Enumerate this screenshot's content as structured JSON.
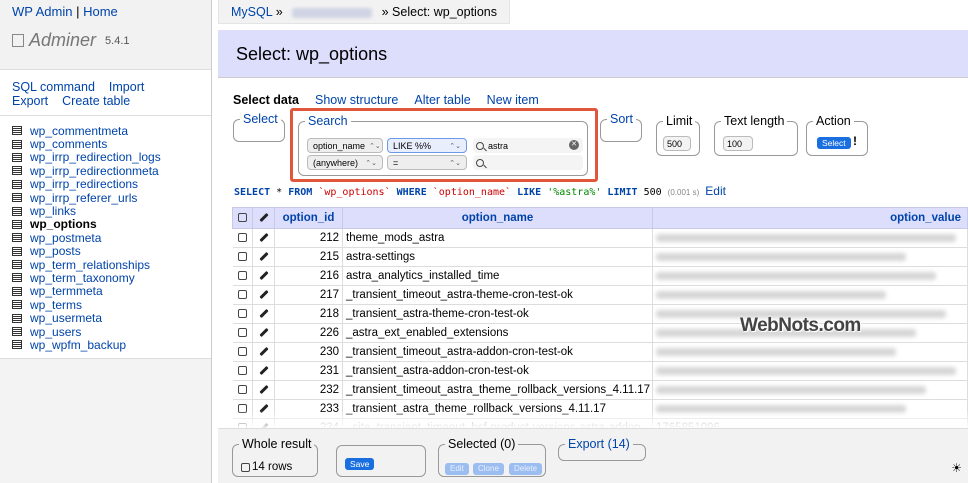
{
  "sidebar": {
    "top_links": [
      "WP Admin",
      "Home"
    ],
    "logo_text": "Adminer",
    "version": "5.4.1",
    "commands": {
      "sql": "SQL command",
      "import": "Import",
      "export": "Export",
      "create": "Create table"
    },
    "tables": [
      {
        "name": "wp_commentmeta",
        "active": false
      },
      {
        "name": "wp_comments",
        "active": false
      },
      {
        "name": "wp_irrp_redirection_logs",
        "active": false
      },
      {
        "name": "wp_irrp_redirectionmeta",
        "active": false
      },
      {
        "name": "wp_irrp_redirections",
        "active": false
      },
      {
        "name": "wp_irrp_referer_urls",
        "active": false
      },
      {
        "name": "wp_links",
        "active": false
      },
      {
        "name": "wp_options",
        "active": true
      },
      {
        "name": "wp_postmeta",
        "active": false
      },
      {
        "name": "wp_posts",
        "active": false
      },
      {
        "name": "wp_term_relationships",
        "active": false
      },
      {
        "name": "wp_term_taxonomy",
        "active": false
      },
      {
        "name": "wp_termmeta",
        "active": false
      },
      {
        "name": "wp_terms",
        "active": false
      },
      {
        "name": "wp_usermeta",
        "active": false
      },
      {
        "name": "wp_users",
        "active": false
      },
      {
        "name": "wp_wpfm_backup",
        "active": false
      }
    ]
  },
  "breadcrumb": {
    "root": "MySQL",
    "sep": "»",
    "current": "» Select: wp_options"
  },
  "page_title": "Select: wp_options",
  "tabs": [
    "Select data",
    "Show structure",
    "Alter table",
    "New item"
  ],
  "form": {
    "select_legend": "Select",
    "search_legend": "Search",
    "search_rows": [
      {
        "column": "option_name",
        "op": "LIKE %%",
        "value": "astra"
      },
      {
        "column": "(anywhere)",
        "op": "=",
        "value": ""
      }
    ],
    "sort_legend": "Sort",
    "limit_legend": "Limit",
    "limit_value": "500",
    "text_length_legend": "Text length",
    "text_length_value": "100",
    "action_legend": "Action",
    "action_button": "Select",
    "action_mark": "!"
  },
  "sql": {
    "select": "SELECT",
    "star": "*",
    "from": "FROM",
    "table": "`wp_options`",
    "where": "WHERE",
    "col": "`option_name`",
    "like": "LIKE",
    "pattern": "'%astra%'",
    "limit": "LIMIT",
    "limit_n": "500",
    "time": "(0.001 s)",
    "edit": "Edit"
  },
  "table": {
    "headers": [
      "option_id",
      "option_name",
      "option_value"
    ],
    "rows": [
      {
        "id": "212",
        "name": "theme_mods_astra"
      },
      {
        "id": "215",
        "name": "astra-settings"
      },
      {
        "id": "216",
        "name": "astra_analytics_installed_time"
      },
      {
        "id": "217",
        "name": "_transient_timeout_astra-theme-cron-test-ok"
      },
      {
        "id": "218",
        "name": "_transient_astra-theme-cron-test-ok"
      },
      {
        "id": "226",
        "name": "_astra_ext_enabled_extensions"
      },
      {
        "id": "230",
        "name": "_transient_timeout_astra-addon-cron-test-ok"
      },
      {
        "id": "231",
        "name": "_transient_astra-addon-cron-test-ok"
      },
      {
        "id": "232",
        "name": "_transient_timeout_astra_theme_rollback_versions_4.11.17"
      },
      {
        "id": "233",
        "name": "_transient_astra_theme_rollback_versions_4.11.17"
      },
      {
        "id": "234",
        "name": "_site_transient_timeout_bsf-product-versions-astra-addon",
        "value": "1765851096"
      }
    ]
  },
  "footer": {
    "whole_legend": "Whole result",
    "rows_label": "14 rows",
    "save_button": "Save",
    "selected_legend": "Selected (0)",
    "edit_button": "Edit",
    "clone_button": "Clone",
    "delete_button": "Delete",
    "export_legend": "Export (14)"
  },
  "watermark": "WebNots.com",
  "colors": {
    "link": "#0044aa",
    "title_bg": "#ddddfc",
    "highlight_border": "#e0573c",
    "button": "#1a6fe0"
  }
}
